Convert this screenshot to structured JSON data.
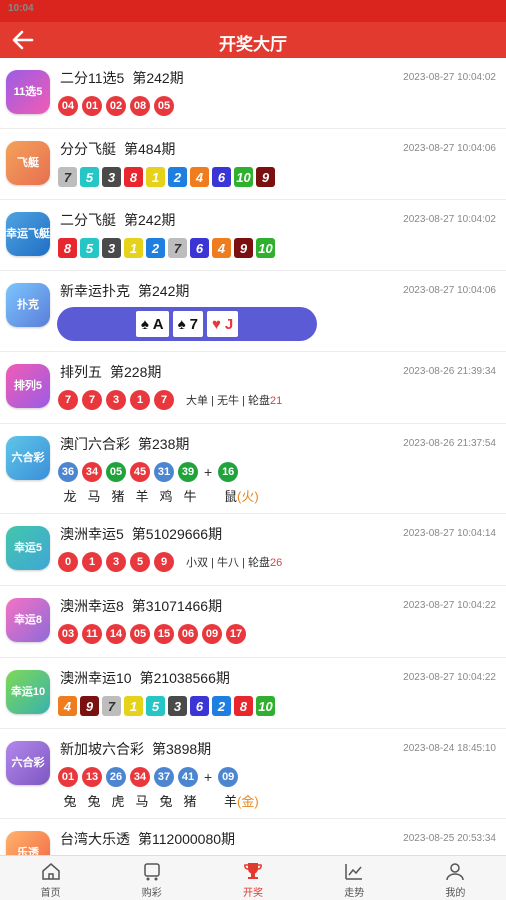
{
  "status_time": "10:04",
  "page_title": "开奖大厅",
  "colors": {
    "brand": "#e23a2e",
    "ball_red": "#e8383d",
    "ball_blue": "#4d86d0",
    "ball_green": "#21a33b"
  },
  "rows": [
    {
      "name": "二分11选5",
      "issue": "第242期",
      "time": "2023-08-27 10:04:02",
      "logo_text": "11选5",
      "type": "balls",
      "balls": [
        "04",
        "01",
        "02",
        "08",
        "05"
      ],
      "colors": [
        "red",
        "red",
        "red",
        "red",
        "red"
      ]
    },
    {
      "name": "分分飞艇",
      "issue": "第484期",
      "time": "2023-08-27 10:04:06",
      "logo_text": "飞艇",
      "type": "squares",
      "squares": [
        "7",
        "5",
        "3",
        "8",
        "1",
        "2",
        "4",
        "6",
        "10",
        "9"
      ]
    },
    {
      "name": "二分飞艇",
      "issue": "第242期",
      "time": "2023-08-27 10:04:02",
      "logo_text": "幸运飞艇",
      "type": "squares",
      "squares": [
        "8",
        "5",
        "3",
        "1",
        "2",
        "7",
        "6",
        "4",
        "9",
        "10"
      ]
    },
    {
      "name": "新幸运扑克",
      "issue": "第242期",
      "time": "2023-08-27 10:04:06",
      "logo_text": "扑克",
      "type": "poker",
      "cards": [
        {
          "suit": "♠",
          "rank": "A"
        },
        {
          "suit": "♠",
          "rank": "7"
        },
        {
          "suit": "♥",
          "rank": "J"
        }
      ]
    },
    {
      "name": "排列五",
      "issue": "第228期",
      "time": "2023-08-26 21:39:34",
      "logo_text": "排列5",
      "type": "balls",
      "balls": [
        "7",
        "7",
        "3",
        "1",
        "7"
      ],
      "colors": [
        "red",
        "red",
        "red",
        "red",
        "red"
      ],
      "extra": "大单 | 无牛 | 轮盘",
      "extra_hl": "21"
    },
    {
      "name": "澳门六合彩",
      "issue": "第238期",
      "time": "2023-08-26 21:37:54",
      "logo_text": "六合彩",
      "type": "lhc",
      "balls": [
        "36",
        "34",
        "05",
        "45",
        "31",
        "39"
      ],
      "colors": [
        "blue",
        "red",
        "green",
        "red",
        "blue",
        "green"
      ],
      "special": "16",
      "special_color": "green",
      "zodiacs": [
        "龙",
        "马",
        "猪",
        "羊",
        "鸡",
        "牛"
      ],
      "special_zodiac": "鼠",
      "special_element": "(火)"
    },
    {
      "name": "澳洲幸运5",
      "issue": "第51029666期",
      "time": "2023-08-27 10:04:14",
      "logo_text": "幸运5",
      "type": "balls",
      "balls": [
        "0",
        "1",
        "3",
        "5",
        "9"
      ],
      "colors": [
        "red",
        "red",
        "red",
        "red",
        "red"
      ],
      "extra": "小双 | 牛八 | 轮盘",
      "extra_hl": "26"
    },
    {
      "name": "澳洲幸运8",
      "issue": "第31071466期",
      "time": "2023-08-27 10:04:22",
      "logo_text": "幸运8",
      "type": "balls",
      "balls": [
        "03",
        "11",
        "14",
        "05",
        "15",
        "06",
        "09",
        "17"
      ],
      "colors": [
        "red",
        "red",
        "red",
        "red",
        "red",
        "red",
        "red",
        "red"
      ]
    },
    {
      "name": "澳洲幸运10",
      "issue": "第21038566期",
      "time": "2023-08-27 10:04:22",
      "logo_text": "幸运10",
      "type": "squares",
      "squares": [
        "4",
        "9",
        "7",
        "1",
        "5",
        "3",
        "6",
        "2",
        "8",
        "10"
      ]
    },
    {
      "name": "新加坡六合彩",
      "issue": "第3898期",
      "time": "2023-08-24 18:45:10",
      "logo_text": "六合彩",
      "type": "lhc",
      "balls": [
        "01",
        "13",
        "26",
        "34",
        "37",
        "41"
      ],
      "colors": [
        "red",
        "red",
        "blue",
        "red",
        "blue",
        "blue"
      ],
      "special": "09",
      "special_color": "blue",
      "zodiacs": [
        "兔",
        "兔",
        "虎",
        "马",
        "兔",
        "猪"
      ],
      "special_zodiac": "羊",
      "special_element": "(金)"
    },
    {
      "name": "台湾大乐透",
      "issue": "第112000080期",
      "time": "2023-08-25 20:53:34",
      "logo_text": "乐透",
      "type": "none"
    }
  ],
  "tabs": [
    {
      "label": "首页",
      "icon": "home-icon"
    },
    {
      "label": "购彩",
      "icon": "cart-icon"
    },
    {
      "label": "开奖",
      "icon": "trophy-icon",
      "active": true
    },
    {
      "label": "走势",
      "icon": "chart-icon"
    },
    {
      "label": "我的",
      "icon": "user-icon"
    }
  ]
}
